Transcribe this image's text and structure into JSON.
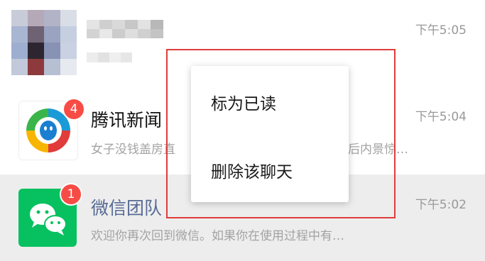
{
  "chats": [
    {
      "title": "",
      "preview": "",
      "time": "下午5:05",
      "avatar_icon": "blurred-avatar-icon",
      "badge": null
    },
    {
      "title": "腾讯新闻",
      "preview": "女子没钱盖房直",
      "preview_tail": "后内景惊…",
      "time": "下午5:04",
      "avatar_icon": "tencent-news-logo-icon",
      "badge": "4"
    },
    {
      "title": "微信团队",
      "preview": "欢迎你再次回到微信。如果你在使用过程中有…",
      "time": "下午5:02",
      "avatar_icon": "wechat-logo-icon",
      "badge": "1"
    }
  ],
  "context_menu": {
    "items": [
      {
        "label": "标为已读"
      },
      {
        "label": "删除该聊天"
      }
    ]
  },
  "colors": {
    "badge": "#f74c46",
    "wechat_green": "#07c160",
    "selected_row": "#ededed",
    "highlight_border": "#e03c3c",
    "title_link": "#576b95"
  }
}
